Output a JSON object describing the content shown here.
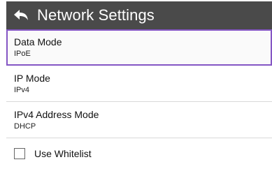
{
  "header": {
    "title": "Network Settings",
    "back_icon": "back-arrow-icon"
  },
  "colors": {
    "header_bg": "#4a4a4a",
    "selection_border": "#8456c4",
    "divider": "#d9d9d9"
  },
  "settings": [
    {
      "label": "Data Mode",
      "value": "IPoE",
      "selected": true
    },
    {
      "label": "IP Mode",
      "value": "IPv4",
      "selected": false
    },
    {
      "label": "IPv4 Address Mode",
      "value": "DHCP",
      "selected": false
    }
  ],
  "whitelist": {
    "label": "Use Whitelist",
    "checked": false
  }
}
